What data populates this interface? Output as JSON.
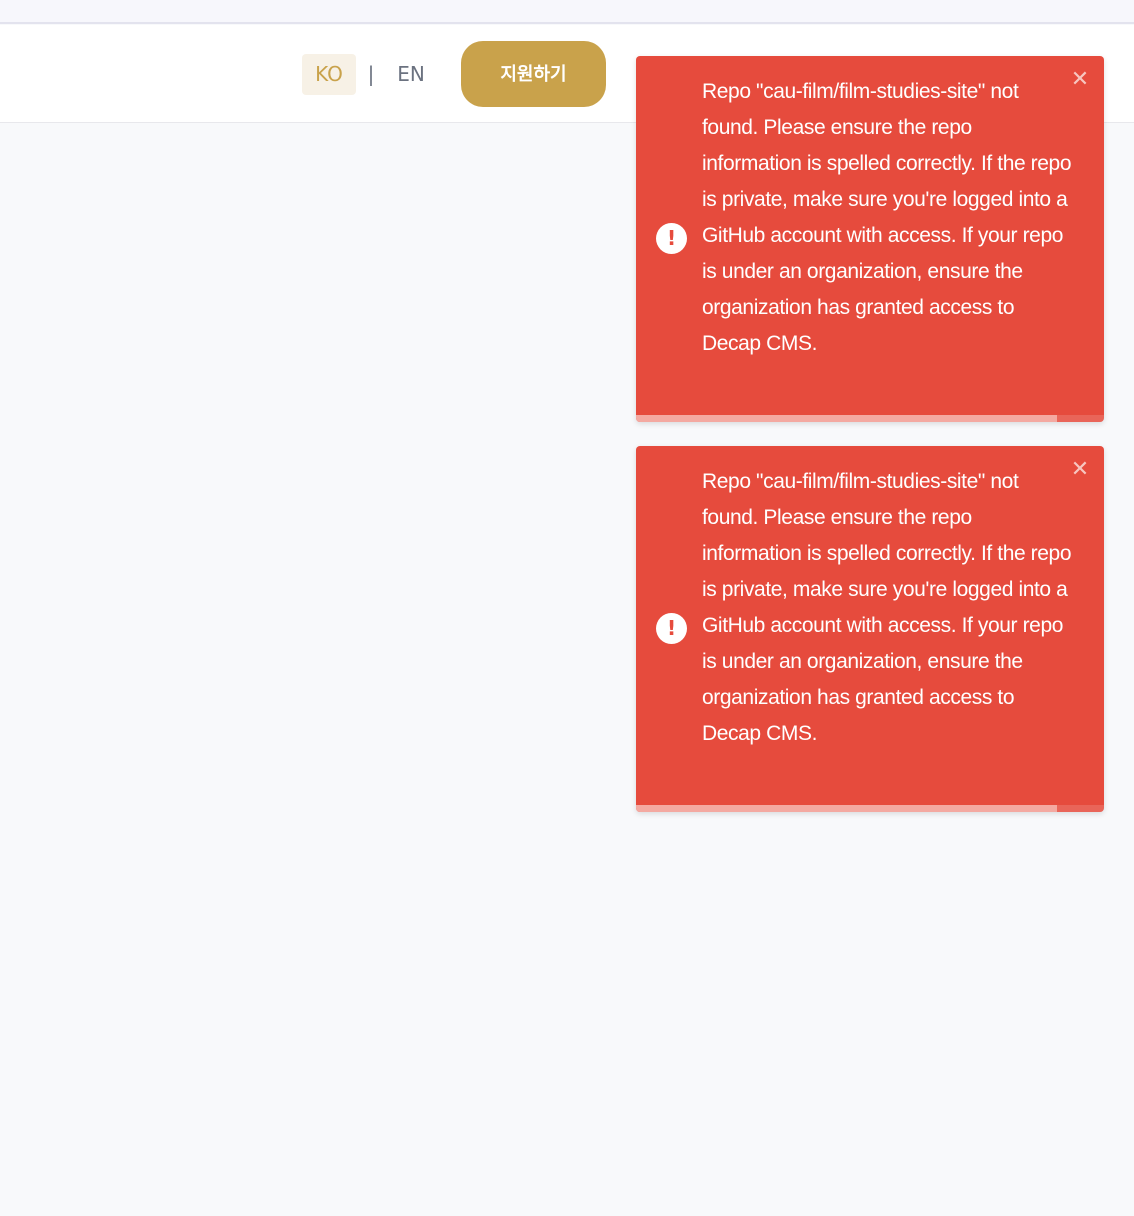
{
  "header": {
    "lang_ko": "KO",
    "lang_separator": "|",
    "lang_en": "EN",
    "apply_label": "지원하기"
  },
  "toasts": [
    {
      "icon": "!",
      "message": "Repo \"cau-film/film-studies-site\" not found. Please ensure the repo information is spelled correctly. If the repo is private, make sure you're logged into a GitHub account with access. If your repo is under an organization, ensure the organization has granted access to Decap CMS.",
      "close": "✕",
      "progress_fraction": 0.9
    },
    {
      "icon": "!",
      "message": "Repo \"cau-film/film-studies-site\" not found. Please ensure the repo information is spelled correctly. If the repo is private, make sure you're logged into a GitHub account with access. If your repo is under an organization, ensure the organization has granted access to Decap CMS.",
      "close": "✕",
      "progress_fraction": 0.9
    }
  ],
  "colors": {
    "accent": "#c9a24b",
    "toast_background": "#e64b3d"
  }
}
